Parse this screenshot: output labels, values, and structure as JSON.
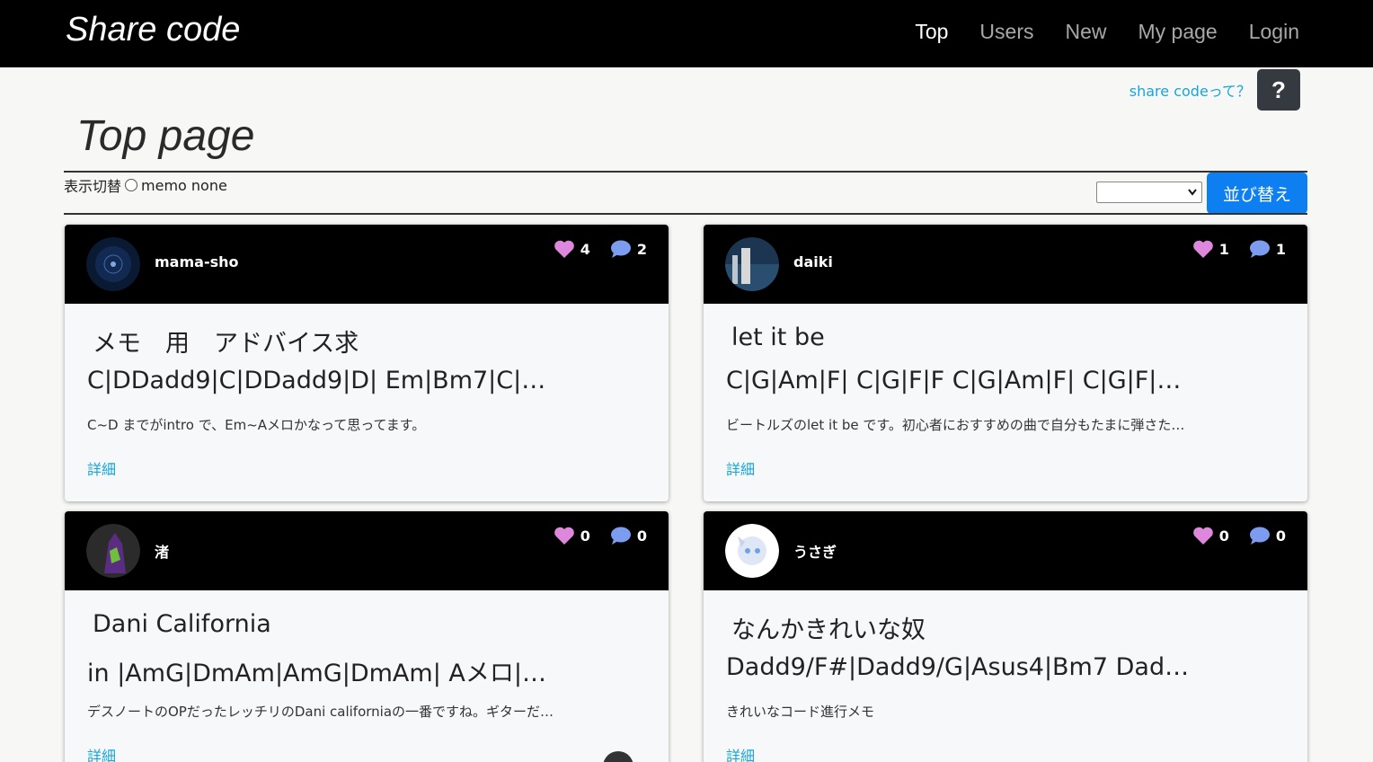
{
  "navbar": {
    "brand": "Share code",
    "items": [
      {
        "label": "Top",
        "active": true
      },
      {
        "label": "Users",
        "active": false
      },
      {
        "label": "New",
        "active": false
      },
      {
        "label": "My page",
        "active": false
      },
      {
        "label": "Login",
        "active": false
      }
    ]
  },
  "help": {
    "link_text": "share codeって？",
    "button_label": "?"
  },
  "page_title": "Top page",
  "display_toggle": {
    "label": "表示切替",
    "option_label": "memo none"
  },
  "sort": {
    "selected": "",
    "button_label": "並び替え"
  },
  "colors": {
    "like": "#dd88dd",
    "comment": "#7c9cf0",
    "link": "#17a6d8",
    "sort_button": "#0d7ff0"
  },
  "cards": [
    {
      "user": "mama-sho",
      "likes": "4",
      "comments": "2",
      "title": "メモ　用　アドバイス求",
      "chords": "C|DDadd9|C|DDadd9|D| Em|Bm7|C|…",
      "description": "C~D までがintro で、Em~Aメロかなって思ってます。",
      "link": "詳細"
    },
    {
      "user": "daiki",
      "likes": "1",
      "comments": "1",
      "title": "let it be",
      "chords": "C|G|Am|F| C|G|F|F C|G|Am|F| C|G|F|…",
      "description": "ビートルズのlet it be です。初心者におすすめの曲で自分もたまに弾さた…",
      "link": "詳細"
    },
    {
      "user": "渚",
      "likes": "0",
      "comments": "0",
      "title": "Dani California",
      "chords": "in |AmG|DmAm|AmG|DmAm| Aメロ|…",
      "description": "デスノートのOPだったレッチリのDani californiaの一番ですね。ギターだ…",
      "link": "詳細"
    },
    {
      "user": "うさぎ",
      "likes": "0",
      "comments": "0",
      "title": "なんかきれいな奴",
      "chords": "Dadd9/F#|Dadd9/G|Asus4|Bm7 Dad…",
      "description": "きれいなコード進行メモ",
      "link": "詳細"
    }
  ]
}
